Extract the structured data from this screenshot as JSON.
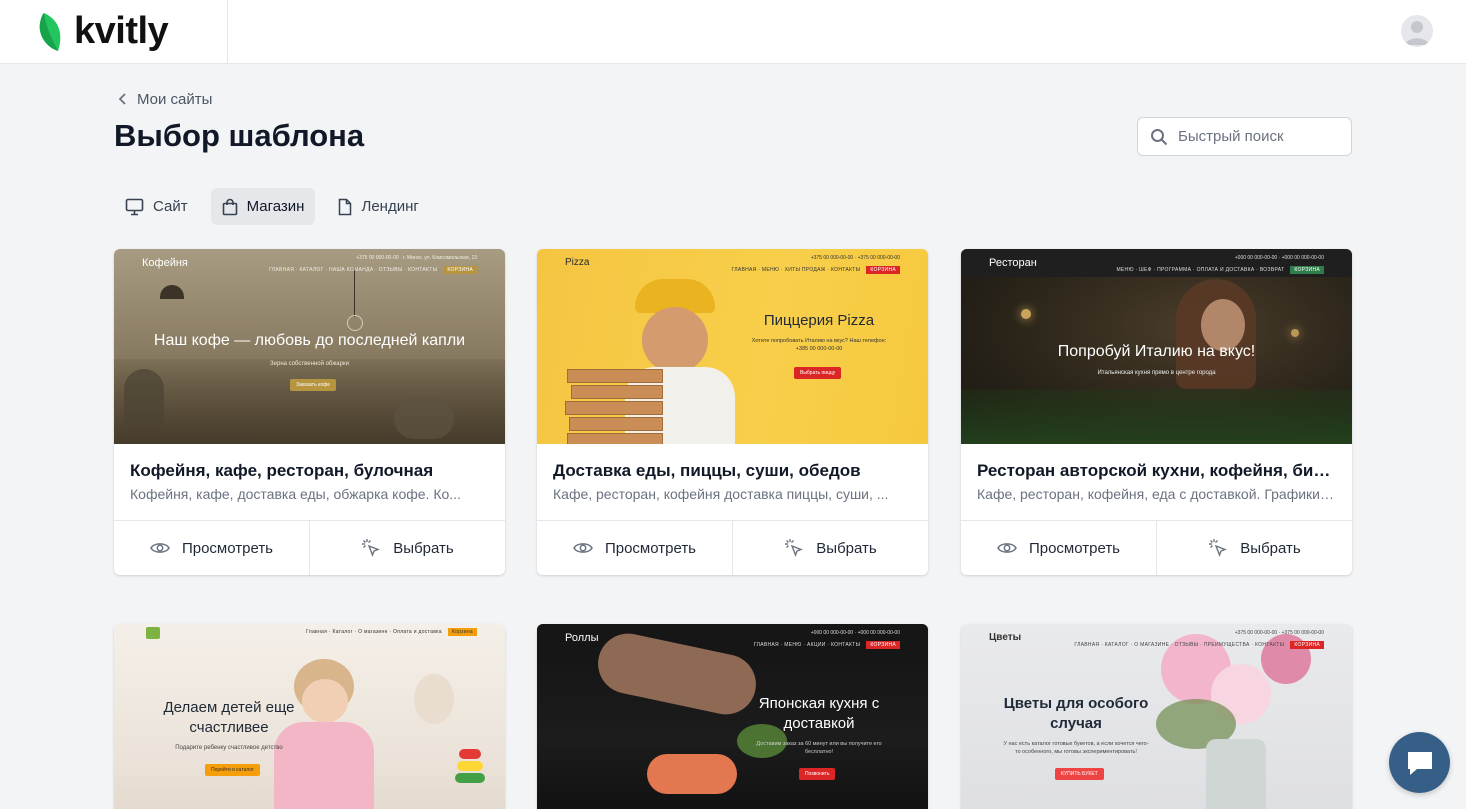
{
  "app": {
    "logo_text": "kvitly"
  },
  "breadcrumb": {
    "label": "Мои сайты"
  },
  "page": {
    "title": "Выбор шаблона"
  },
  "search": {
    "placeholder": "Быстрый поиск"
  },
  "tabs": [
    {
      "label": "Сайт",
      "icon": "monitor-icon",
      "active": false
    },
    {
      "label": "Магазин",
      "icon": "shopping-bag-icon",
      "active": true
    },
    {
      "label": "Лендинг",
      "icon": "file-icon",
      "active": false
    }
  ],
  "actions": {
    "preview_label": "Просмотреть",
    "select_label": "Выбрать"
  },
  "templates": [
    {
      "title": "Кофейня, кафе, ресторан, булочная",
      "description": "Кофейня, кафе, доставка еды, обжарка кофе. Ко...",
      "preview": {
        "brand": "Кофейня",
        "menu": "ГЛАВНАЯ · КАТАЛОГ · НАША КОМАНДА · ОТЗЫВЫ · КОНТАКТЫ",
        "cart": "КОРЗИНА",
        "phones": "+375 00 000-00-00 · г. Минск, ул. Комсомольская, 13",
        "hero_title": "Наш кофе — любовь до последней капли",
        "hero_sub": "Зерна собственной обжарки",
        "button": "Заказать кофе"
      }
    },
    {
      "title": "Доставка еды, пиццы, суши, обедов",
      "description": "Кафе, ресторан, кофейня доставка пиццы, суши, ...",
      "preview": {
        "brand": "Pizza",
        "menu": "ГЛАВНАЯ · МЕНЮ · ХИТЫ ПРОДАЖ · КОНТАКТЫ",
        "cart": "КОРЗИНА",
        "phones": "+375 00 000-00-00 · +375 00 000-00-00",
        "hero_title": "Пиццерия Pizza",
        "hero_sub": "Хотите попробовать Италию на вкус? Наш телефон: +385 00 000-00-00",
        "button": "Выбрать пиццу"
      }
    },
    {
      "title": "Ресторан авторской кухни, кофейня, бистро",
      "description": "Кафе, ресторан, кофейня, еда с доставкой. Графики работы",
      "preview": {
        "brand": "Ресторан",
        "menu": "МЕНЮ · ШЕФ · ПРОГРАММА · ОПЛАТА И ДОСТАВКА · ВОЗВРАТ",
        "cart": "КОРЗИНА",
        "phones": "+000 00 000-00-00 · +000 00 000-00-00",
        "hero_title": "Попробуй Италию на вкус!",
        "hero_sub": "Итальянская кухня прямо в центре города",
        "button": ""
      }
    },
    {
      "title": "",
      "description": "",
      "preview": {
        "brand": "",
        "menu": "Главная · Каталог · О магазине · Оплата и доставка",
        "cart": "Корзина",
        "phones": "",
        "hero_title": "Делаем детей еще счастливее",
        "hero_sub": "Подарите ребенку счастливое детство",
        "button": "Перейти в каталог"
      }
    },
    {
      "title": "",
      "description": "",
      "preview": {
        "brand": "Роллы",
        "menu": "ГЛАВНАЯ · МЕНЮ · АКЦИИ · КОНТАКТЫ",
        "cart": "КОРЗИНА",
        "phones": "+000 00 000-00-00 · +000 00 000-00-00",
        "hero_title": "Японская кухня с доставкой",
        "hero_sub": "Доставим заказ за 60 минут или вы получите его бесплатно!",
        "button": "Позвонить"
      }
    },
    {
      "title": "",
      "description": "",
      "preview": {
        "brand": "Цветы",
        "menu": "ГЛАВНАЯ · КАТАЛОГ · О МАГАЗИНЕ · ОТЗЫВЫ · ПРЕИМУЩЕСТВА · КОНТАКТЫ",
        "cart": "КОРЗИНА",
        "phones": "+375 00 000-00-00 · +375 00 000-00-00",
        "hero_title": "Цветы для особого случая",
        "hero_sub": "У нас есть каталог готовых букетов, а если хочется чего-то особенного, мы готовы экспериментировать!",
        "button": "КУПИТЬ БУКЕТ"
      }
    }
  ],
  "colors": {
    "accent": "#365f87",
    "brand_green": "#22c55e",
    "background": "#f3f4f6"
  }
}
